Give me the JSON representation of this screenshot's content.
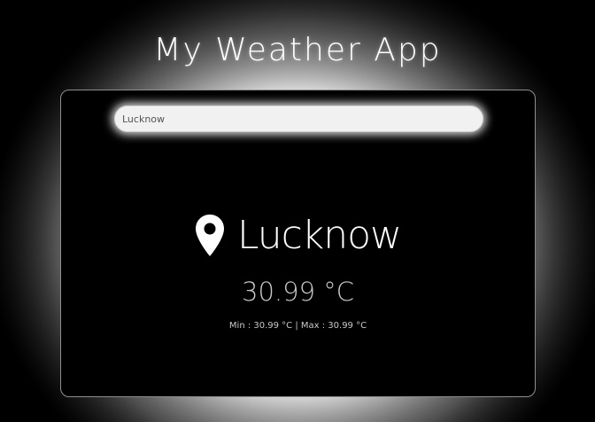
{
  "app": {
    "title": "My Weather App"
  },
  "search": {
    "value": "Lucknow",
    "placeholder": ""
  },
  "weather": {
    "city": "Lucknow",
    "temperature": "30.99 °C",
    "min_max": "Min : 30.99 °C | Max : 30.99 °C"
  },
  "icons": {
    "location": "map-pin-icon"
  },
  "colors": {
    "page_background": "#000000",
    "glow": "#ffffff",
    "card_background": "#000000",
    "card_border": "#8e8e8e",
    "search_background": "#f1f1f1",
    "text_primary": "#ffffff",
    "text_secondary": "#c8c8c8"
  }
}
